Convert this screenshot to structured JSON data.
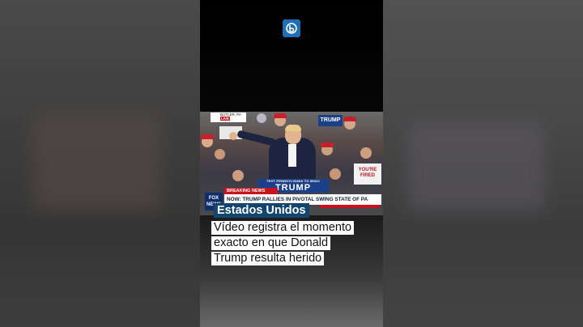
{
  "brand": {
    "logo_icon": "b-icon",
    "accent": "#1f6fb8"
  },
  "video": {
    "location_bug": "BUTLER, PA",
    "live_label": "LIVE",
    "network_bug": "FOX NEWS",
    "breaking_label": "BREAKING NEWS",
    "headline": "NOW: TRUMP RALLIES IN PIVOTAL SWING STATE OF PA",
    "podium_small": "TEXT PENNSYLVANIA TO 88022",
    "podium_big": "TRUMP",
    "crowd_sign_1": "TRUMP",
    "crowd_sign_2": "YOU'RE FIRED"
  },
  "caption": {
    "category": "Estados Unidos",
    "line1": "Vídeo registra el momento",
    "line2": "exacto en que Donald",
    "line3": "Trump resulta herido"
  },
  "colors": {
    "category_bg": "#14456f",
    "breaking_red": "#c8141e",
    "caption_bg": "#ffffff"
  }
}
